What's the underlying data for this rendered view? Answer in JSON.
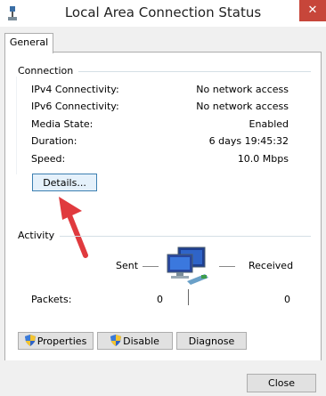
{
  "window": {
    "title": "Local Area Connection Status"
  },
  "tabs": [
    {
      "label": "General"
    }
  ],
  "connection": {
    "heading": "Connection",
    "rows": [
      {
        "label": "IPv4 Connectivity:",
        "value": "No network access"
      },
      {
        "label": "IPv6 Connectivity:",
        "value": "No network access"
      },
      {
        "label": "Media State:",
        "value": "Enabled"
      },
      {
        "label": "Duration:",
        "value": "6 days 19:45:32"
      },
      {
        "label": "Speed:",
        "value": "10.0 Mbps"
      }
    ],
    "details_label": "Details..."
  },
  "activity": {
    "heading": "Activity",
    "sent_label": "Sent",
    "received_label": "Received",
    "packets_label": "Packets:",
    "packets_sent": "0",
    "packets_received": "0"
  },
  "actions": {
    "properties_label": "Properties",
    "disable_label": "Disable",
    "diagnose_label": "Diagnose"
  },
  "footer": {
    "close_label": "Close"
  },
  "colors": {
    "annotation_arrow": "#e03a3e",
    "close_glyph_bg": "#c7463a",
    "accent_border": "#3c7fb1"
  },
  "icons": [
    "network-connection-icon",
    "close-icon",
    "network-computers-icon",
    "uac-shield-icon",
    "red-arrow-annotation"
  ]
}
